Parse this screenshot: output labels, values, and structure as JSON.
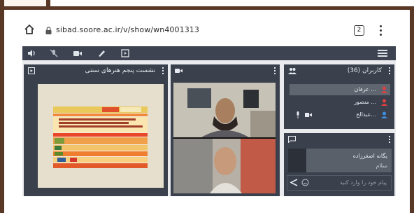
{
  "browser": {
    "url": "sibad.soore.ac.ir/v/show/wn4001313",
    "tab_count": "2"
  },
  "toolbar": {
    "icons": [
      "speaker-icon",
      "mic-off-icon",
      "camera-icon",
      "pen-icon",
      "screen-share-icon",
      "hamburger-icon"
    ]
  },
  "presentation": {
    "title": "نشست پنجم هنرهای سنتی"
  },
  "users": {
    "title": "کاربران (36)",
    "list": [
      {
        "name": "عرفان ...",
        "color": "#e04040"
      },
      {
        "name": "منصور ...",
        "color": "#e04040"
      },
      {
        "name": "عبدالح...",
        "color": "#3f8fe0"
      }
    ]
  },
  "chat": {
    "sender": "یگانه اصغرزاده",
    "message": "سلام",
    "placeholder": "پیام خود را وارد کنید"
  },
  "colors": {
    "frame": "#5a3826",
    "toolbar": "#3d4350",
    "panel": "#3a404c"
  }
}
